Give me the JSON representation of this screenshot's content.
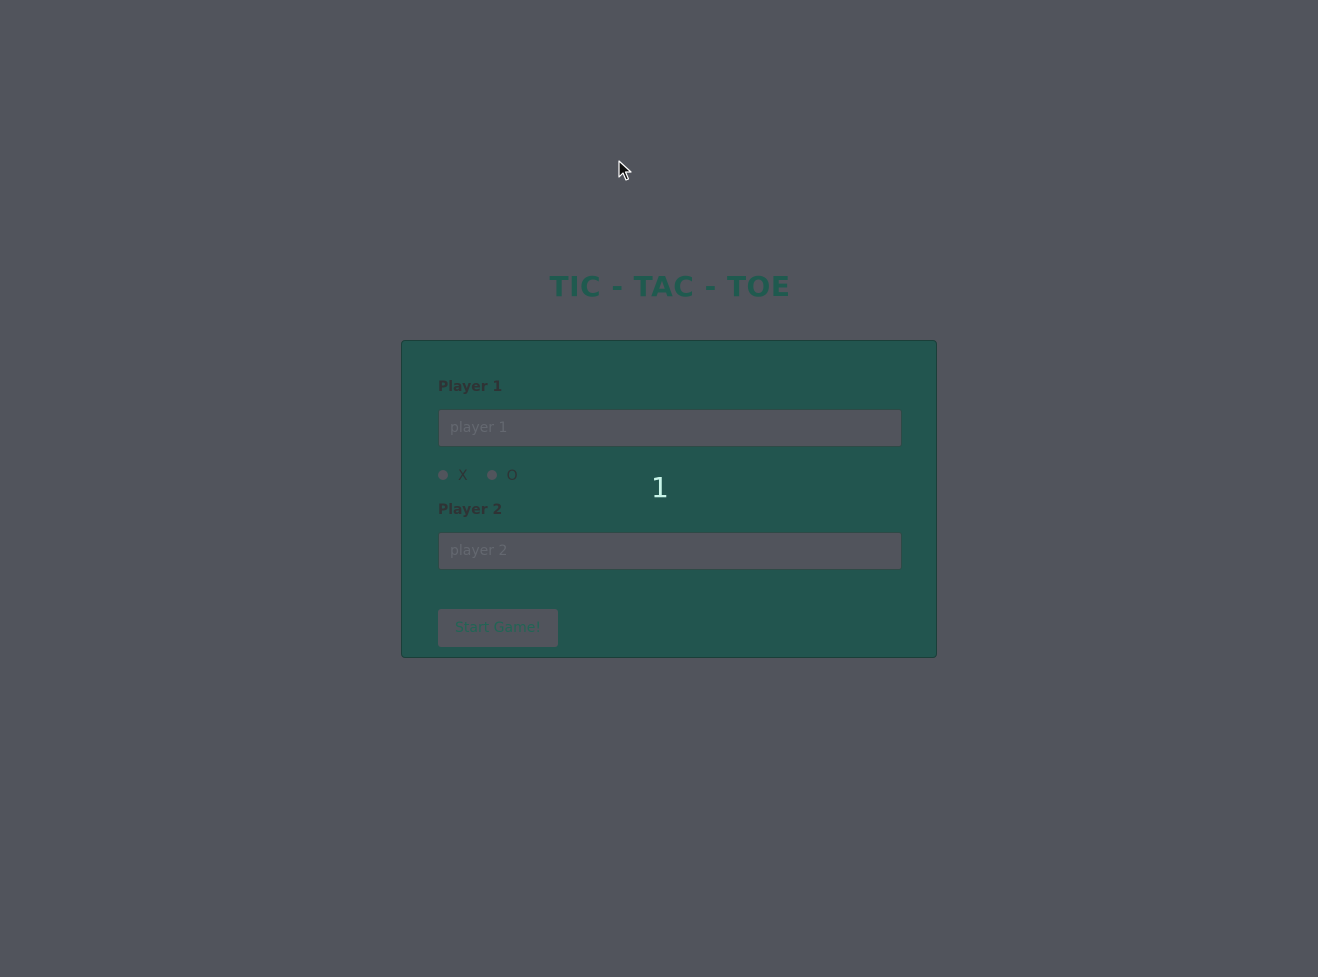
{
  "app": {
    "title": "TIC - TAC - TOE"
  },
  "form": {
    "player1": {
      "label": "Player 1",
      "placeholder": "player 1",
      "value": ""
    },
    "symbols": [
      {
        "label": "X"
      },
      {
        "label": "O"
      }
    ],
    "player2": {
      "label": "Player 2",
      "placeholder": "player 2",
      "value": ""
    },
    "start_label": "Start Game!"
  },
  "overlay": {
    "counter": "1"
  },
  "colors": {
    "background": "#51545c",
    "card": "#22554f",
    "title": "#1f5a4f",
    "button_text": "#216555",
    "counter_text": "#c8f5e9"
  }
}
